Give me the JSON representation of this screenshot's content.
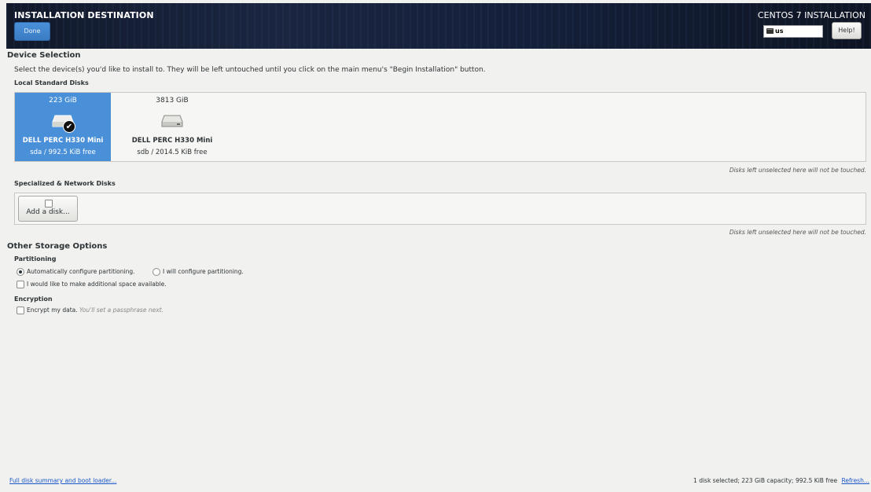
{
  "header": {
    "title": "INSTALLATION DESTINATION",
    "done_label": "Done",
    "product": "CENTOS 7 INSTALLATION",
    "keyboard_layout": "us",
    "help_label": "Help!"
  },
  "device_selection": {
    "heading": "Device Selection",
    "instructions": "Select the device(s) you'd like to install to.  They will be left untouched until you click on the main menu's \"Begin Installation\" button.",
    "local_heading": "Local Standard Disks",
    "disks": [
      {
        "size": "223 GiB",
        "name": "DELL PERC H330 Mini",
        "info": "sda  /  992.5 KiB free",
        "selected": true
      },
      {
        "size": "3813 GiB",
        "name": "DELL PERC H330 Mini",
        "info": "sdb  /  2014.5 KiB free",
        "selected": false
      }
    ],
    "untouched_note": "Disks left unselected here will not be touched.",
    "network_heading": "Specialized & Network Disks",
    "add_disk_label": "Add a disk...",
    "network_note": "Disks left unselected here will not be touched."
  },
  "other_storage": {
    "heading": "Other Storage Options",
    "partitioning_heading": "Partitioning",
    "auto_label": "Automatically configure partitioning.",
    "manual_label": "I will configure partitioning.",
    "auto_selected": true,
    "extra_space_label": "I would like to make additional space available.",
    "encryption_heading": "Encryption",
    "encrypt_label": "Encrypt my data.",
    "encrypt_hint": "You'll set a passphrase next."
  },
  "footer": {
    "summary_link": "Full disk summary and boot loader...",
    "status": "1 disk selected; 223 GiB capacity; 992.5 KiB free",
    "refresh_link": "Refresh..."
  },
  "colors": {
    "accent": "#4a90d9",
    "header_bg": "#14203a",
    "link": "#1a57c9"
  }
}
